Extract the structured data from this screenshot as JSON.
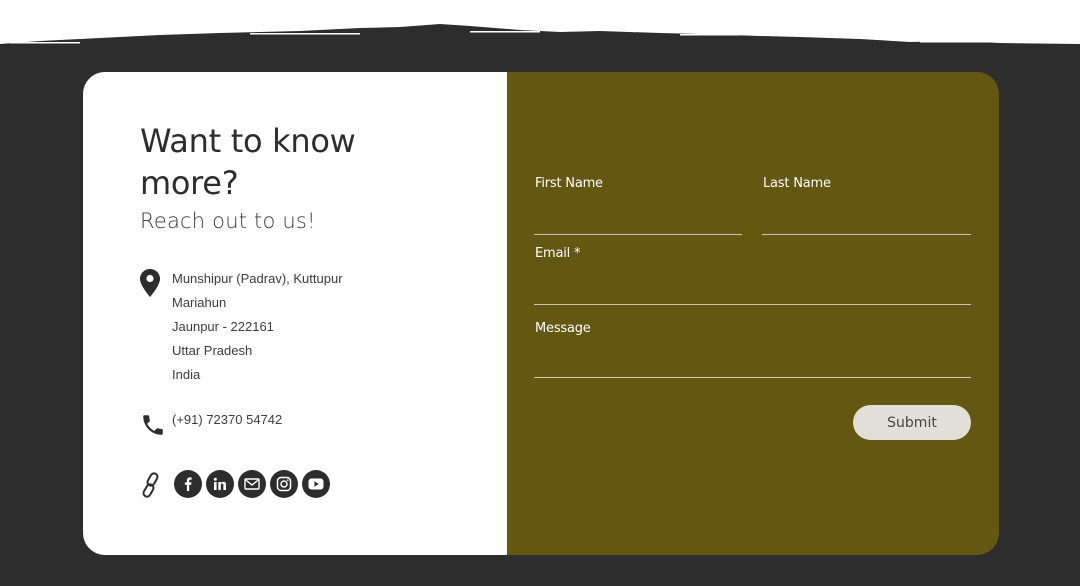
{
  "colors": {
    "page_background": "#2d2d2d",
    "card_left": "#ffffff",
    "form_panel": "#645711",
    "text_dark": "#2d2d2d",
    "input_line": "#c8c6b3",
    "button_bg": "#e1e0d8"
  },
  "contact": {
    "heading": "Want to know more?",
    "subheading": "Reach out to us!",
    "address_lines": [
      "Munshipur (Padrav), Kuttupur",
      "Mariahun",
      "Jaunpur - 222161",
      "Uttar Pradesh",
      "India"
    ],
    "phone": "(+91) 72370 54742",
    "social_icons": [
      "facebook-icon",
      "linkedin-icon",
      "email-icon",
      "instagram-icon",
      "youtube-icon"
    ]
  },
  "form": {
    "first_name_label": "First Name",
    "first_name_value": "",
    "last_name_label": "Last Name",
    "last_name_value": "",
    "email_label": "Email *",
    "email_value": "",
    "message_label": "Message",
    "message_value": "",
    "submit_label": "Submit"
  }
}
